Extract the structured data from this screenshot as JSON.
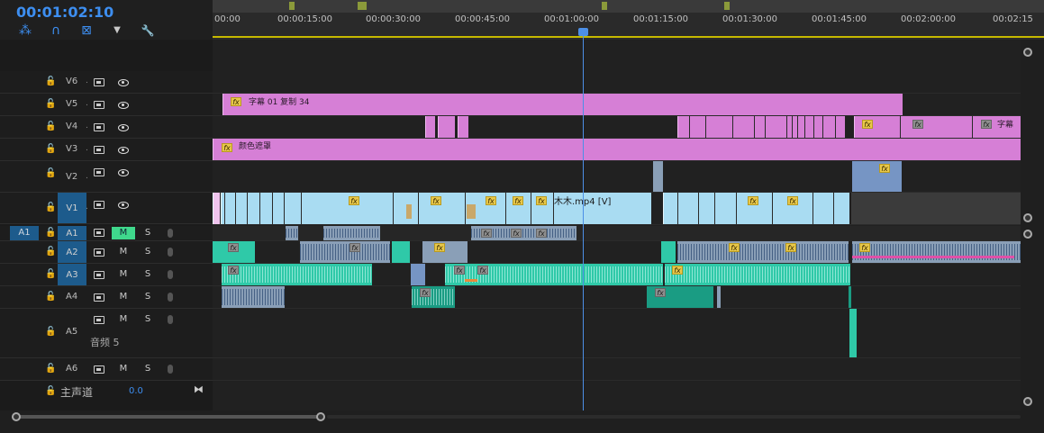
{
  "timecode": "00:01:02:10",
  "tools": [
    {
      "name": "snap-icon",
      "glyph": "⁂"
    },
    {
      "name": "link-icon",
      "glyph": "∩"
    },
    {
      "name": "linked-selection-icon",
      "glyph": "⊠"
    },
    {
      "name": "add-marker-icon",
      "glyph": "▼"
    },
    {
      "name": "wrench-icon",
      "glyph": "🔧"
    }
  ],
  "ruler_ticks": [
    "00:00",
    "00:00:15:00",
    "00:00:30:00",
    "00:00:45:00",
    "00:01:00:00",
    "00:01:15:00",
    "00:01:30:00",
    "00:01:45:00",
    "00:02:00:00",
    "00:02:15"
  ],
  "tracks": {
    "video": [
      {
        "name": "V6"
      },
      {
        "name": "V5"
      },
      {
        "name": "V4"
      },
      {
        "name": "V3"
      },
      {
        "name": "V2"
      },
      {
        "name": "V1",
        "selected": true
      }
    ],
    "audio": [
      {
        "name": "A1",
        "source": "A1",
        "m_on": true,
        "m": "M",
        "s": "S"
      },
      {
        "name": "A2",
        "m": "M",
        "s": "S"
      },
      {
        "name": "A3",
        "m": "M",
        "s": "S"
      },
      {
        "name": "A4",
        "m": "M",
        "s": "S"
      },
      {
        "name": "A5",
        "label": "音频 5",
        "m": "M",
        "s": "S"
      },
      {
        "name": "A6",
        "m": "M",
        "s": "S"
      }
    ]
  },
  "clips": {
    "v5_title": "字幕 01 复制 34",
    "v4_title_right": "字幕",
    "v3_title": "颜色遮罩",
    "v1_title": "木木.mp4 [V]"
  },
  "fx_label": "fx",
  "master": {
    "label": "主声道",
    "value": "0.0"
  },
  "colors": {
    "accent": "#3d8ef0",
    "playhead": "#4c8fe6",
    "title_clip": "#d67fd6",
    "video_clip": "#a9dcf2",
    "audio_clip": "#1a9c83"
  }
}
